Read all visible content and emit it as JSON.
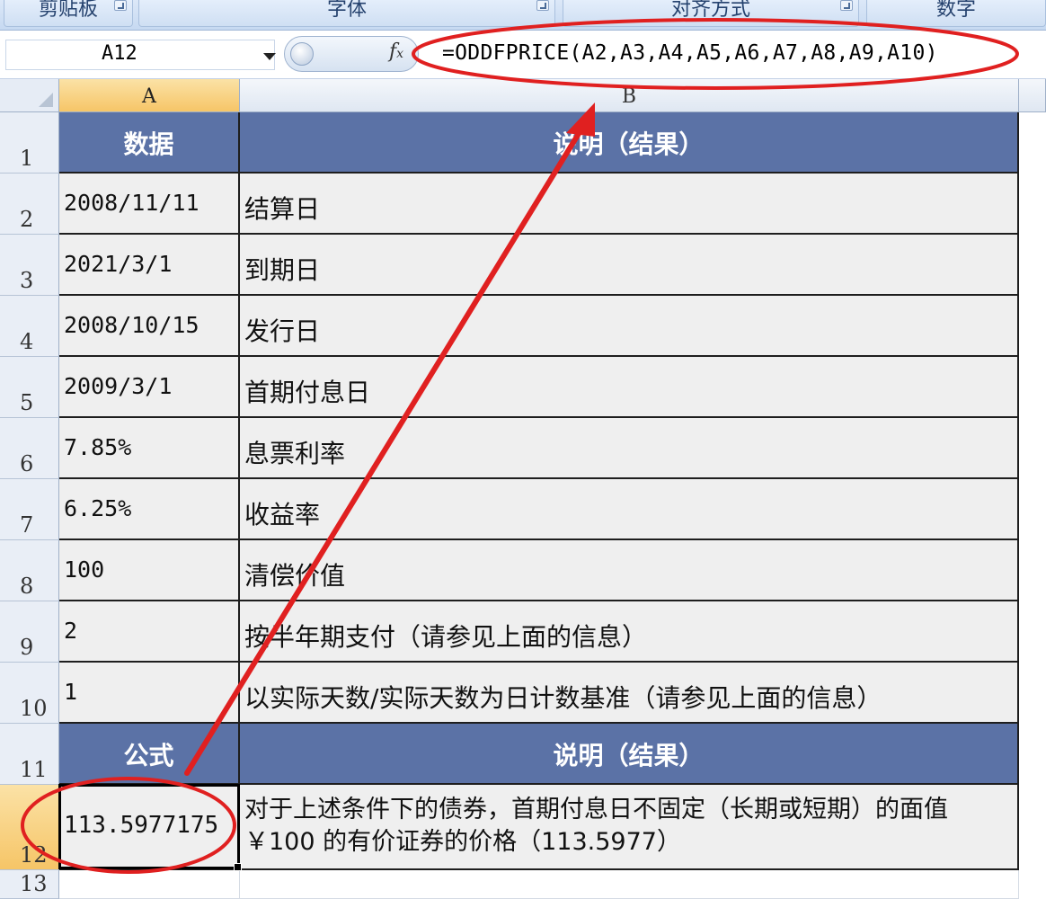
{
  "ribbon": {
    "groups": [
      "剪贴板",
      "字体",
      "对齐方式",
      "数字"
    ]
  },
  "formula_bar": {
    "name_box": "A12",
    "fx_label": "fx",
    "formula": "=ODDFPRICE(A2,A3,A4,A5,A6,A7,A8,A9,A10)"
  },
  "columns": [
    "A",
    "B"
  ],
  "rows": [
    {
      "num": "1",
      "a": "数据",
      "b": "说明（结果）"
    },
    {
      "num": "2",
      "a": "2008/11/11",
      "b": "结算日"
    },
    {
      "num": "3",
      "a": "2021/3/1",
      "b": "到期日"
    },
    {
      "num": "4",
      "a": "2008/10/15",
      "b": "发行日"
    },
    {
      "num": "5",
      "a": "2009/3/1",
      "b": "首期付息日"
    },
    {
      "num": "6",
      "a": "7.85%",
      "b": "息票利率"
    },
    {
      "num": "7",
      "a": "6.25%",
      "b": "收益率"
    },
    {
      "num": "8",
      "a": "100",
      "b": "清偿价值"
    },
    {
      "num": "9",
      "a": "2",
      "b": "按半年期支付（请参见上面的信息）"
    },
    {
      "num": "10",
      "a": "1",
      "b": "以实际天数/实际天数为日计数基准（请参见上面的信息）"
    },
    {
      "num": "11",
      "a": "公式",
      "b": "说明（结果）"
    },
    {
      "num": "12",
      "a": "113.5977175",
      "b": "对于上述条件下的债券，首期付息日不固定（长期或短期）的面值 ￥100 的有价证券的价格（113.5977）"
    },
    {
      "num": "13",
      "a": "",
      "b": ""
    }
  ],
  "colors": {
    "header_fill": "#5b72a6",
    "cell_fill": "#efefef",
    "annotation": "#e02020",
    "selected_header": "#f6c567"
  }
}
